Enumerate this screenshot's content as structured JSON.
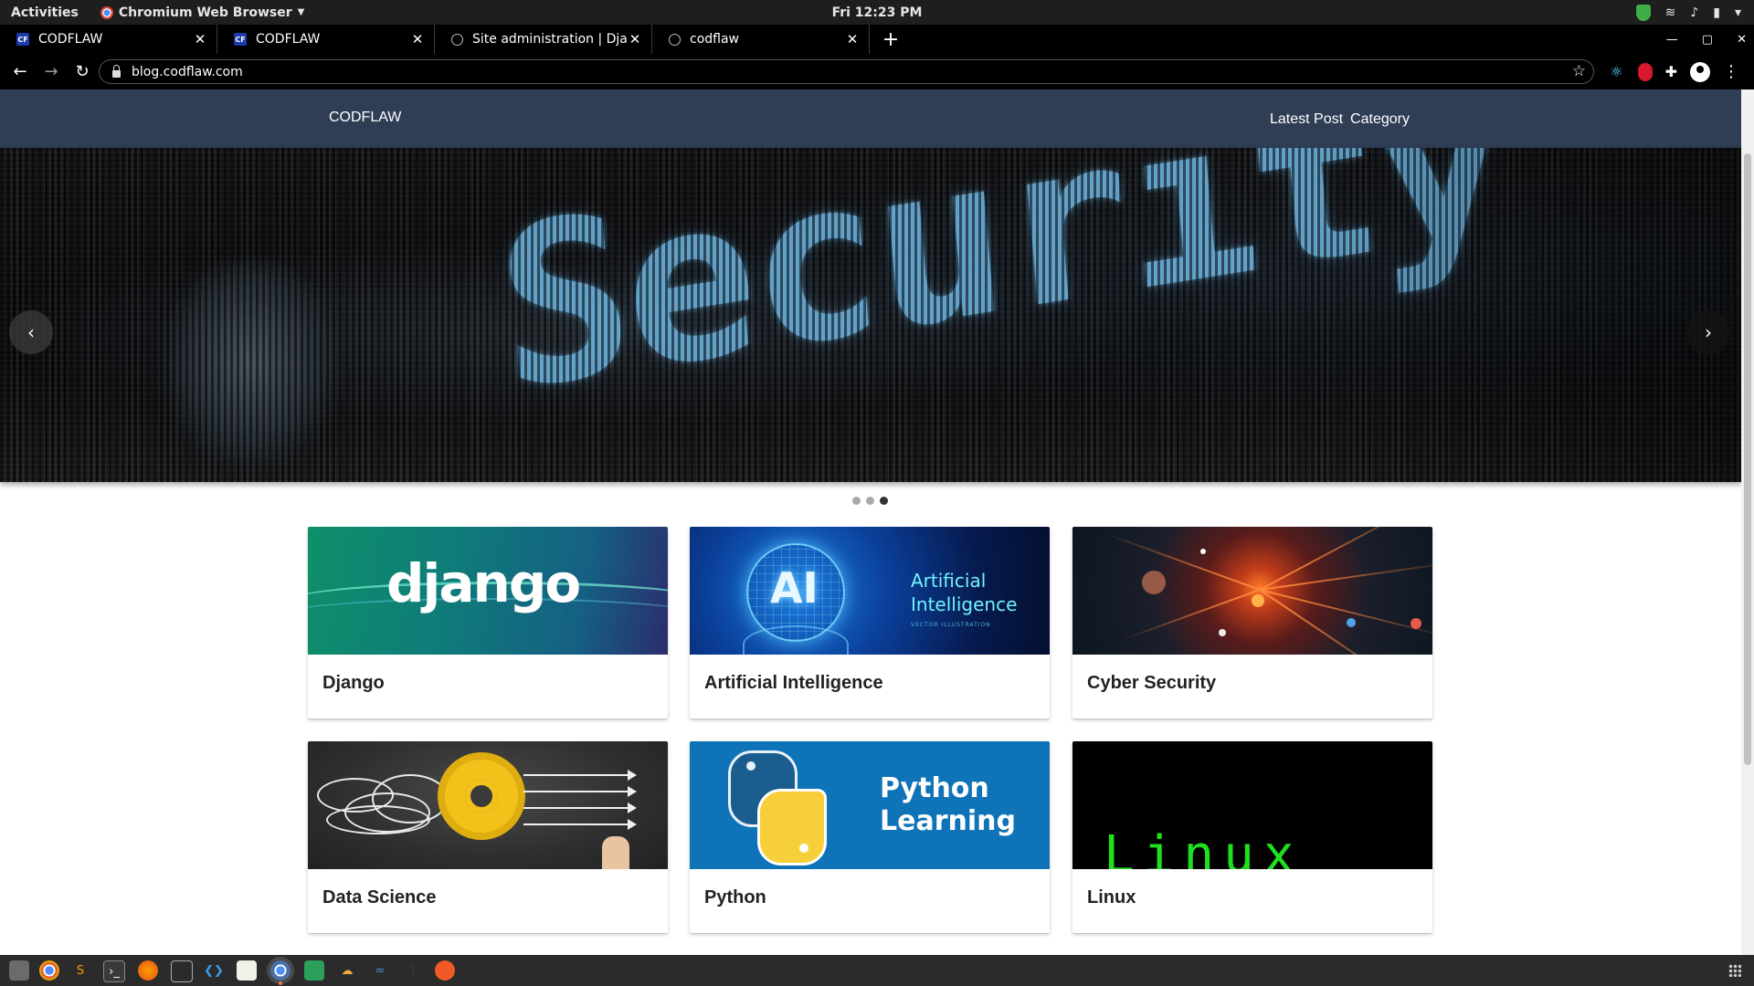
{
  "system_bar": {
    "activities": "Activities",
    "app_name": "Chromium Web Browser",
    "clock": "Fri 12:23 PM"
  },
  "browser": {
    "tabs": [
      {
        "title": "CODFLAW",
        "favicon": "CF",
        "active": false
      },
      {
        "title": "CODFLAW",
        "favicon": "CF",
        "active": true
      },
      {
        "title": "Site administration | Djan",
        "favicon": "globe-icon",
        "active": false
      },
      {
        "title": "codflaw",
        "favicon": "globe-icon",
        "active": false
      }
    ],
    "url": "blog.codflaw.com"
  },
  "site": {
    "brand": "CODFLAW",
    "nav": [
      {
        "label": "Latest Post"
      },
      {
        "label": "Category"
      }
    ],
    "hero": {
      "image_word": "Security",
      "slide_count": 3,
      "active_slide": 3
    },
    "categories": [
      {
        "title": "Django",
        "image_text": "django"
      },
      {
        "title": "Artificial Intelligence",
        "image_text": "AI",
        "image_caption": "Artificial Intelligence",
        "image_sub": "VECTOR ILLUSTRATION"
      },
      {
        "title": "Cyber Security"
      },
      {
        "title": "Data Science"
      },
      {
        "title": "Python",
        "image_caption": "Python Learning"
      },
      {
        "title": "Linux",
        "image_text": "Linux"
      }
    ]
  },
  "colors": {
    "site_nav_bg": "#2f3e55",
    "browser_chrome": "#000000",
    "taskbar": "#2b2b2b"
  }
}
